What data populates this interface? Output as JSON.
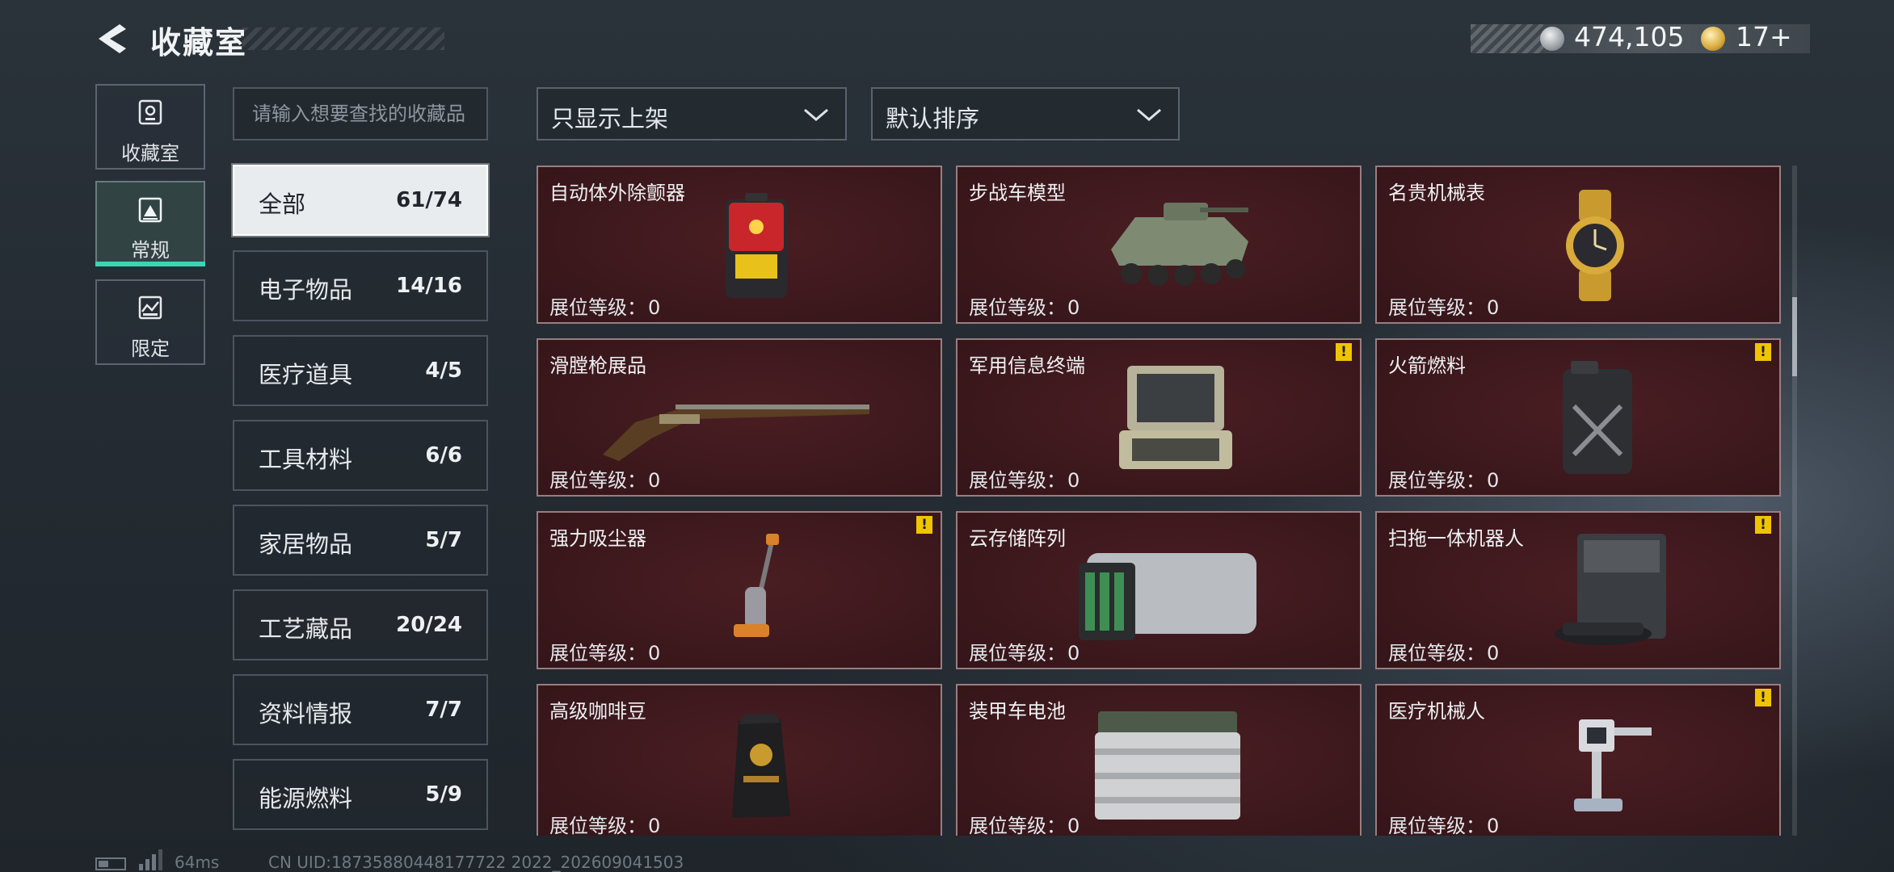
{
  "header": {
    "title": "收藏室",
    "silver_currency": "474,105",
    "gold_currency": "17+"
  },
  "nav": [
    {
      "label": "收藏室",
      "icon": "trophy-icon"
    },
    {
      "label": "常规",
      "icon": "collection-frame-icon",
      "active": true
    },
    {
      "label": "限定",
      "icon": "limited-frame-icon"
    }
  ],
  "search": {
    "placeholder": "请输入想要查找的收藏品"
  },
  "filters": {
    "display_filter": "只显示上架",
    "sort": "默认排序"
  },
  "categories": [
    {
      "label": "全部",
      "count": "61/74",
      "active": true
    },
    {
      "label": "电子物品",
      "count": "14/16"
    },
    {
      "label": "医疗道具",
      "count": "4/5"
    },
    {
      "label": "工具材料",
      "count": "6/6"
    },
    {
      "label": "家居物品",
      "count": "5/7"
    },
    {
      "label": "工艺藏品",
      "count": "20/24"
    },
    {
      "label": "资料情报",
      "count": "7/7"
    },
    {
      "label": "能源燃料",
      "count": "5/9"
    }
  ],
  "level_label": "展位等级：",
  "items": [
    {
      "name": "自动体外除颤器",
      "level": "0",
      "warning": false,
      "icon": "defibrillator-icon"
    },
    {
      "name": "步战车模型",
      "level": "0",
      "warning": false,
      "icon": "ifv-model-icon"
    },
    {
      "name": "名贵机械表",
      "level": "0",
      "warning": false,
      "icon": "luxury-watch-icon"
    },
    {
      "name": "滑膛枪展品",
      "level": "0",
      "warning": false,
      "icon": "musket-icon"
    },
    {
      "name": "军用信息终端",
      "level": "0",
      "warning": true,
      "icon": "military-terminal-icon"
    },
    {
      "name": "火箭燃料",
      "level": "0",
      "warning": true,
      "icon": "rocket-fuel-can-icon"
    },
    {
      "name": "强力吸尘器",
      "level": "0",
      "warning": true,
      "icon": "vacuum-cleaner-icon"
    },
    {
      "name": "云存储阵列",
      "level": "0",
      "warning": false,
      "icon": "storage-array-icon"
    },
    {
      "name": "扫拖一体机器人",
      "level": "0",
      "warning": true,
      "icon": "mopping-robot-icon"
    },
    {
      "name": "高级咖啡豆",
      "level": "0",
      "warning": false,
      "icon": "coffee-bag-icon"
    },
    {
      "name": "装甲车电池",
      "level": "0",
      "warning": false,
      "icon": "battery-icon"
    },
    {
      "name": "医疗机械人",
      "level": "0",
      "warning": true,
      "icon": "medical-robot-icon"
    }
  ],
  "warning_mark": "!",
  "footer": {
    "ping": "64ms",
    "uid": "CN UID:18735880448177722 2022_202609041503"
  }
}
